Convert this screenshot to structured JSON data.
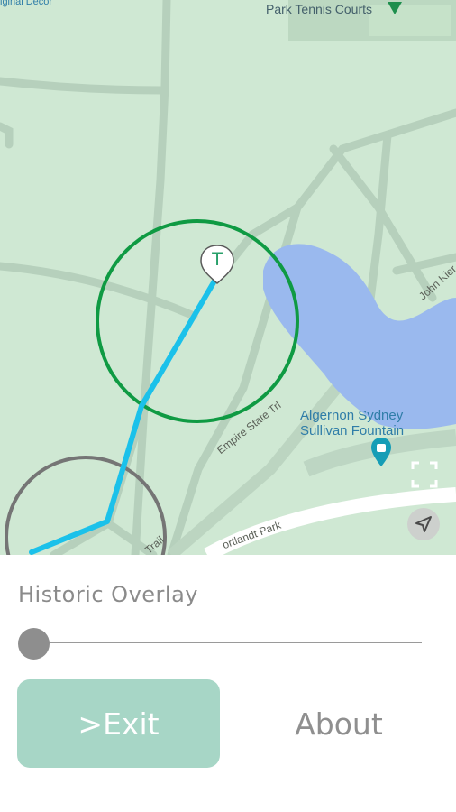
{
  "map": {
    "labels": {
      "top_left": "iginal Decor",
      "tennis": "Park Tennis Courts",
      "fountain_line1": "Algernon Sydney",
      "fountain_line2": "Sullivan Fountain",
      "street_empire": "Empire State Trl",
      "street_john": "John Kier",
      "street_cortlandt": "ortlandt Park",
      "street_trail": "Trail"
    },
    "marker_label": "T",
    "icons": {
      "marker": "map-pin-icon",
      "fountain": "fountain-pin-icon",
      "fullscreen": "fullscreen-icon",
      "locate": "navigation-arrow-icon"
    },
    "colors": {
      "route": "#1bc1ea",
      "geofence_active": "#0f9a43",
      "geofence_inactive": "#757575",
      "water": "#9ab9ee",
      "park": "#cfe8d3"
    }
  },
  "panel": {
    "title": "Historic Overlay",
    "slider_value": 0,
    "exit_label": ">Exit",
    "about_label": "About",
    "colors": {
      "exit_button": "#a7d6c6",
      "text_gray": "#8b8b8b"
    }
  }
}
